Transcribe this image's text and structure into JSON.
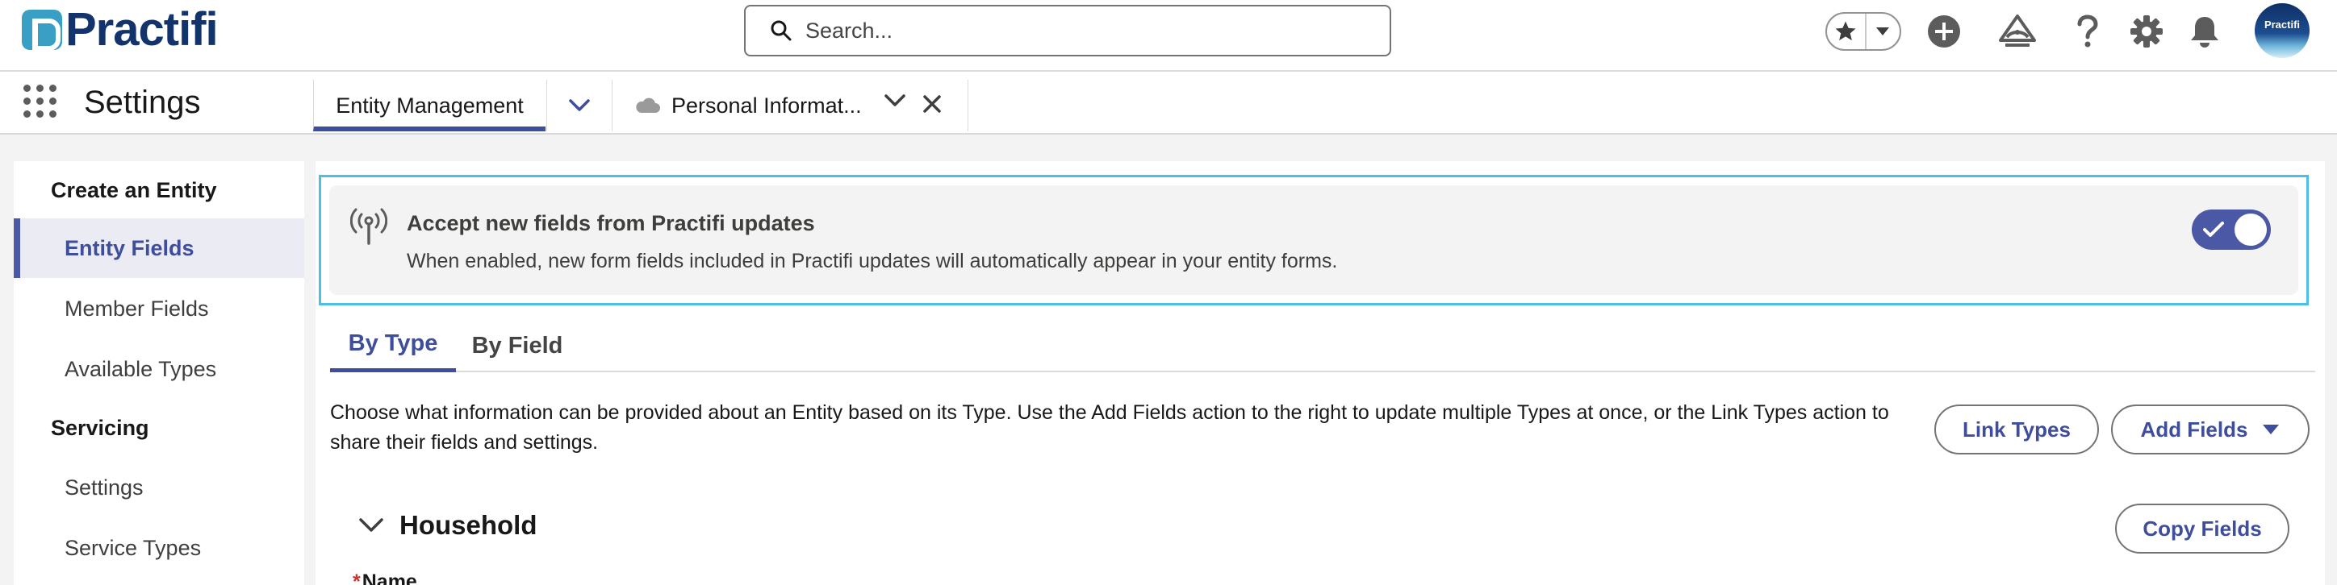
{
  "header": {
    "logo_text": "Practifi",
    "search_placeholder": "Search...",
    "icons": [
      "star-icon",
      "chevron-down-icon",
      "plus-icon",
      "trailhead-icon",
      "help-icon",
      "gear-icon",
      "bell-icon"
    ],
    "avatar_text": "Practifi"
  },
  "nav": {
    "app_name": "Settings",
    "tabs": [
      {
        "label": "Entity Management",
        "active": true
      },
      {
        "label": "Personal Informat...",
        "active": false
      }
    ]
  },
  "sidebar": {
    "sections": [
      {
        "title": "Create an Entity",
        "items": [
          {
            "label": "Entity Fields",
            "active": true
          },
          {
            "label": "Member Fields",
            "active": false
          },
          {
            "label": "Available Types",
            "active": false
          }
        ]
      },
      {
        "title": "Servicing",
        "items": [
          {
            "label": "Settings",
            "active": false
          },
          {
            "label": "Service Types",
            "active": false
          }
        ]
      }
    ]
  },
  "banner": {
    "title": "Accept new fields from Practifi updates",
    "subtitle": "When enabled, new form fields included in Practifi updates will automatically appear in your entity forms.",
    "toggle_on": true
  },
  "subtabs": [
    {
      "label": "By Type",
      "active": true
    },
    {
      "label": "By Field",
      "active": false
    }
  ],
  "description": "Choose what information can be provided about an Entity based on its Type. Use the Add Fields action to the right to update multiple Types at once, or the Link Types action to share their fields and settings.",
  "buttons": {
    "link_types": "Link Types",
    "add_fields": "Add Fields",
    "copy_fields": "Copy Fields"
  },
  "group": {
    "title": "Household",
    "first_field_required_marker": "*",
    "first_field_label": "Name"
  },
  "colors": {
    "brand_accent": "#3e4d9c",
    "highlight_border": "#4cbfe8",
    "logo_blue": "#12336b"
  }
}
